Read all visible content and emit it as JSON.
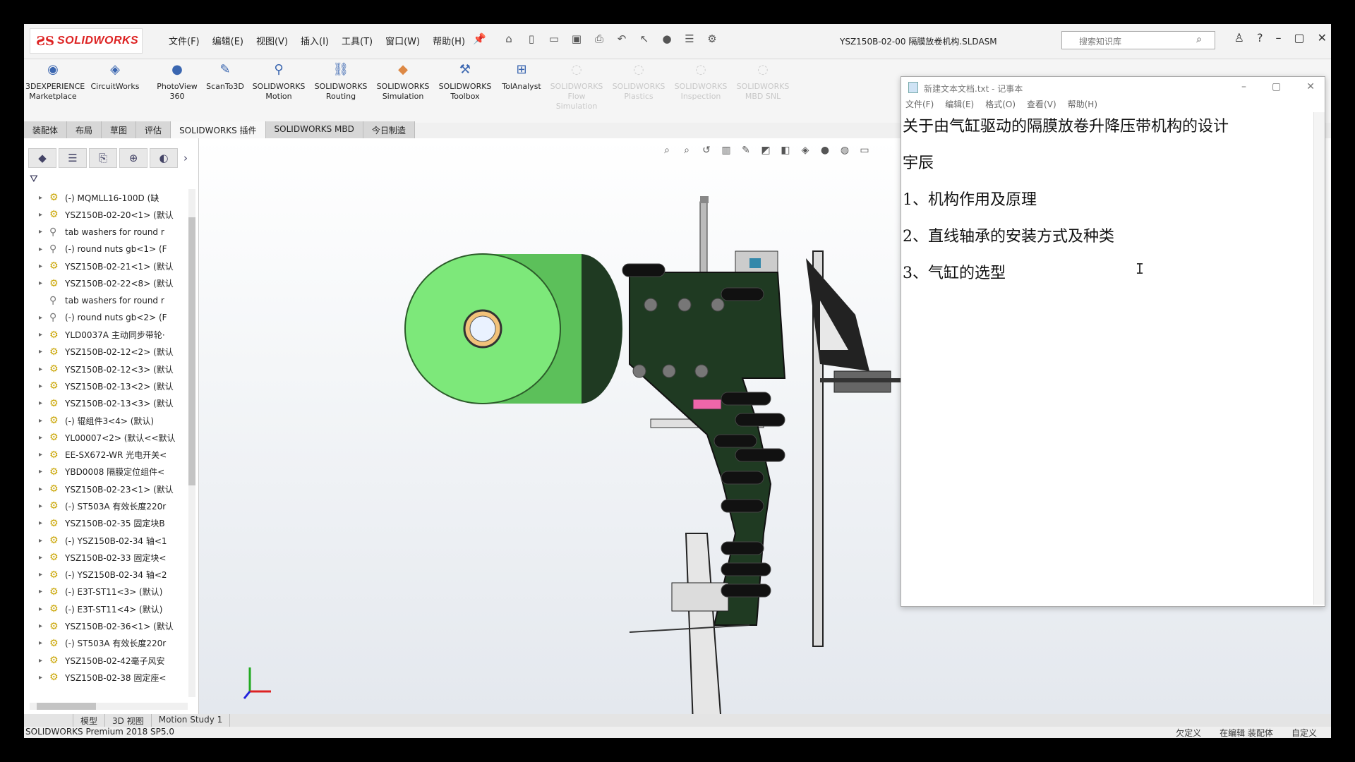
{
  "app": {
    "logo_mark": "ƧS",
    "logo_text": "SOLIDWORKS",
    "filename": "YSZ150B-02-00 隔膜放卷机构.SLDASM",
    "search_placeholder": "搜索知识库"
  },
  "menu": [
    "文件(F)",
    "编辑(E)",
    "视图(V)",
    "插入(I)",
    "工具(T)",
    "窗口(W)",
    "帮助(H)"
  ],
  "commands": [
    {
      "label1": "3DEXPERIENCE",
      "label2": "Marketplace",
      "icon": "cube-icon",
      "enabled": true
    },
    {
      "label1": "CircuitWorks",
      "label2": "",
      "icon": "circuit-icon",
      "enabled": true
    },
    {
      "label1": "PhotoView",
      "label2": "360",
      "icon": "render-icon",
      "enabled": true
    },
    {
      "label1": "ScanTo3D",
      "label2": "",
      "icon": "scan-icon",
      "enabled": true
    },
    {
      "label1": "SOLIDWORKS",
      "label2": "Motion",
      "icon": "motion-icon",
      "enabled": true
    },
    {
      "label1": "SOLIDWORKS",
      "label2": "Routing",
      "icon": "routing-icon",
      "enabled": true
    },
    {
      "label1": "SOLIDWORKS",
      "label2": "Simulation",
      "icon": "simulation-icon",
      "enabled": true
    },
    {
      "label1": "SOLIDWORKS",
      "label2": "Toolbox",
      "icon": "toolbox-icon",
      "enabled": true
    },
    {
      "label1": "TolAnalyst",
      "label2": "",
      "icon": "tolanalyst-icon",
      "enabled": true
    },
    {
      "label1": "SOLIDWORKS",
      "label2": "Flow",
      "label3": "Simulation",
      "icon": "flow-icon",
      "enabled": false
    },
    {
      "label1": "SOLIDWORKS",
      "label2": "Plastics",
      "icon": "plastics-icon",
      "enabled": false
    },
    {
      "label1": "SOLIDWORKS",
      "label2": "Inspection",
      "icon": "inspection-icon",
      "enabled": false
    },
    {
      "label1": "SOLIDWORKS",
      "label2": "MBD SNL",
      "icon": "mbd-icon",
      "enabled": false
    }
  ],
  "tabs": [
    "装配体",
    "布局",
    "草图",
    "评估",
    "SOLIDWORKS 插件",
    "SOLIDWORKS MBD",
    "今日制造"
  ],
  "tree_items": [
    {
      "text": "(-) MQMLL16-100D  (缺",
      "icon": "assembly"
    },
    {
      "text": "YSZ150B-02-20<1> (默认",
      "icon": "assembly"
    },
    {
      "text": "tab washers for round r",
      "icon": "toolbox"
    },
    {
      "text": "(-) round nuts gb<1> (F",
      "icon": "toolbox"
    },
    {
      "text": "YSZ150B-02-21<1> (默认",
      "icon": "assembly"
    },
    {
      "text": "YSZ150B-02-22<8> (默认",
      "icon": "assembly"
    },
    {
      "text": "tab washers for round r",
      "icon": "toolbox"
    },
    {
      "text": "(-) round nuts gb<2> (F",
      "icon": "toolbox"
    },
    {
      "text": "YLD0037A 主动同步带轮·",
      "icon": "assembly"
    },
    {
      "text": "YSZ150B-02-12<2> (默认",
      "icon": "assembly"
    },
    {
      "text": "YSZ150B-02-12<3> (默认",
      "icon": "assembly"
    },
    {
      "text": "YSZ150B-02-13<2> (默认",
      "icon": "assembly"
    },
    {
      "text": "YSZ150B-02-13<3> (默认",
      "icon": "assembly"
    },
    {
      "text": "(-) 辊组件3<4> (默认)",
      "icon": "assembly"
    },
    {
      "text": "YL00007<2> (默认<<默认",
      "icon": "assembly"
    },
    {
      "text": "EE-SX672-WR 光电开关<",
      "icon": "assembly"
    },
    {
      "text": "YBD0008 隔膜定位组件<",
      "icon": "assembly"
    },
    {
      "text": "YSZ150B-02-23<1> (默认",
      "icon": "assembly"
    },
    {
      "text": "(-) ST503A 有效长度220r",
      "icon": "assembly"
    },
    {
      "text": "YSZ150B-02-35 固定块B",
      "icon": "assembly"
    },
    {
      "text": "(-) YSZ150B-02-34 轴<1",
      "icon": "assembly"
    },
    {
      "text": "YSZ150B-02-33 固定块<",
      "icon": "assembly"
    },
    {
      "text": "(-) YSZ150B-02-34 轴<2",
      "icon": "assembly"
    },
    {
      "text": "(-) E3T-ST11<3> (默认)",
      "icon": "assembly"
    },
    {
      "text": "(-) E3T-ST11<4> (默认)",
      "icon": "assembly"
    },
    {
      "text": "YSZ150B-02-36<1> (默认",
      "icon": "assembly"
    },
    {
      "text": "(-) ST503A 有效长度220r",
      "icon": "assembly"
    },
    {
      "text": "YSZ150B-02-42毫子风安",
      "icon": "assembly"
    },
    {
      "text": "YSZ150B-02-38 固定座<",
      "icon": "assembly"
    }
  ],
  "bottom_tabs": [
    "模型",
    "3D 视图",
    "Motion Study 1"
  ],
  "status": {
    "left": "SOLIDWORKS Premium 2018 SP5.0",
    "r1": "欠定义",
    "r2": "在编辑 装配体",
    "r3": "自定义"
  },
  "notepad": {
    "title": "新建文本文档.txt - 记事本",
    "menu": [
      "文件(F)",
      "编辑(E)",
      "格式(O)",
      "查看(V)",
      "帮助(H)"
    ],
    "lines": [
      "关于由气缸驱动的隔膜放卷升降压带机构的设计",
      "宇辰",
      "1、机构作用及原理",
      "2、直线轴承的安装方式及种类",
      "3、气缸的选型"
    ],
    "caret": "I"
  },
  "colors": {
    "roll_green": "#7de87a",
    "belt_dark": "#1f3a22",
    "brand_red": "#d22222"
  }
}
